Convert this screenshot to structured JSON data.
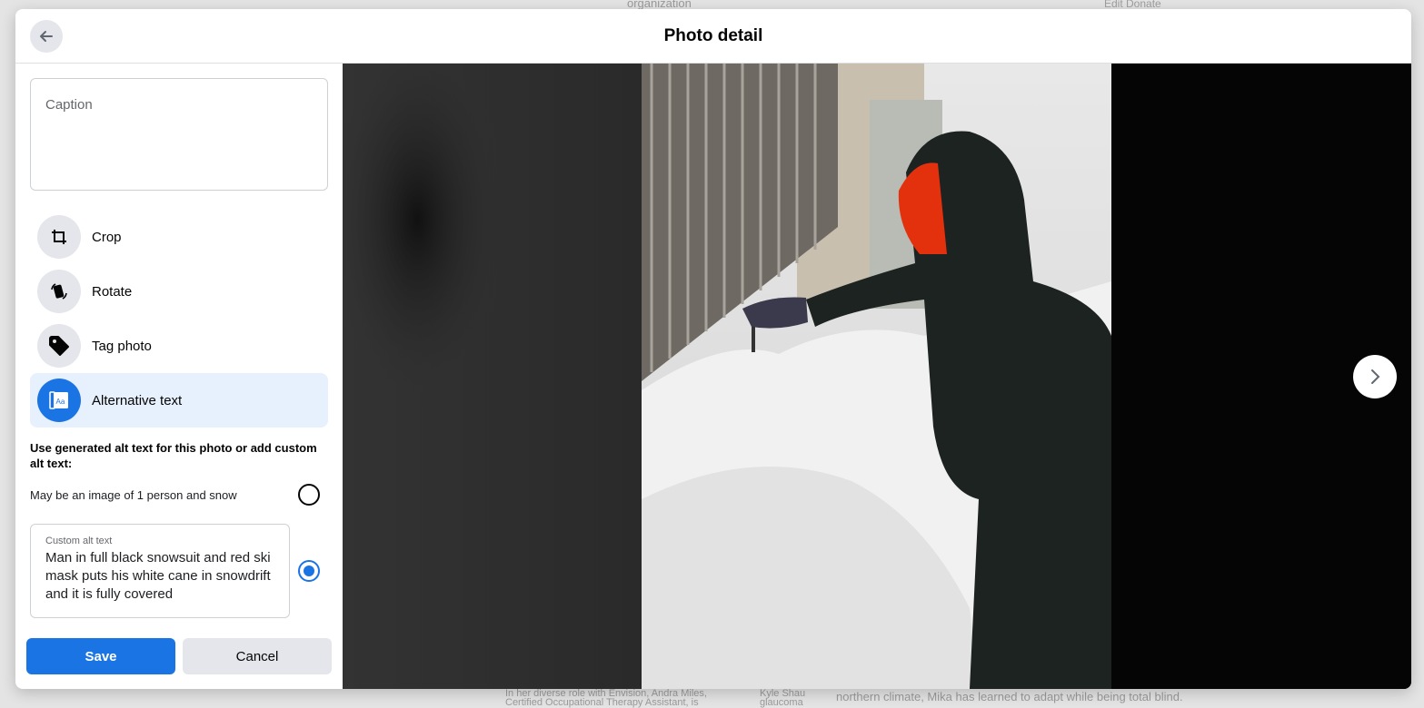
{
  "background": {
    "fragments": [
      "organization",
      "Edit Donate",
      "In her diverse role with Envision, Andra Miles,",
      "Certified Occupational Therapy Assistant, is",
      "Kyle Shau",
      "glaucoma",
      "northern climate, Mika has learned to adapt while being total blind."
    ]
  },
  "header": {
    "title": "Photo detail",
    "back_icon": "arrow-left-icon"
  },
  "sidebar": {
    "caption_placeholder": "Caption",
    "menu": [
      {
        "label": "Crop",
        "icon": "crop-icon"
      },
      {
        "label": "Rotate",
        "icon": "rotate-icon"
      },
      {
        "label": "Tag photo",
        "icon": "tag-icon"
      },
      {
        "label": "Alternative text",
        "icon": "alt-text-icon",
        "active": true
      }
    ],
    "alt_heading": "Use generated alt text for this photo or add custom alt text:",
    "generated_alt": "May be an image of 1 person and snow",
    "generated_selected": false,
    "custom_label": "Custom alt text",
    "custom_value": "Man in full black snowsuit and red ski mask puts his white cane in snowdrift and it is fully covered",
    "custom_selected": true,
    "save_label": "Save",
    "cancel_label": "Cancel"
  },
  "viewer": {
    "next_icon": "chevron-right-icon"
  },
  "colors": {
    "accent": "#1b74e4",
    "active_bg": "#e7f0fd",
    "button_gray": "#e4e6eb"
  }
}
